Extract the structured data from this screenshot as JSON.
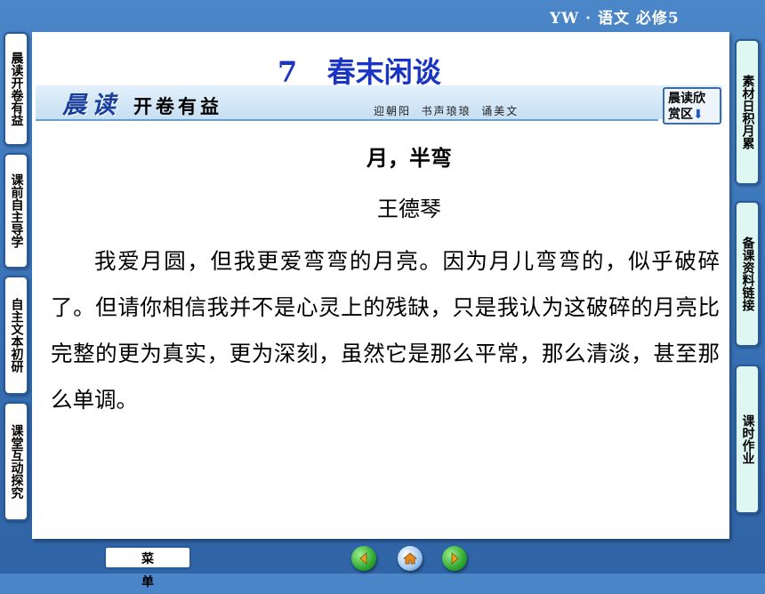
{
  "header": {
    "course": "YW · 语文   必修5"
  },
  "lesson": {
    "title": "7   春末闲谈"
  },
  "banner": {
    "brand": "晨读",
    "tagline": "开卷有益",
    "motto": "迎朝阳  书声琅琅  诵美文"
  },
  "appreciate_button": {
    "line1": "晨读欣",
    "line2": "赏区",
    "arrow": "⬇"
  },
  "poem": {
    "title": "月，半弯",
    "author": "王德琴",
    "body": "我爱月圆，但我更爱弯弯的月亮。因为月儿弯弯的，似乎破碎了。但请你相信我并不是心灵上的残缺，只是我认为这破碎的月亮比完整的更为真实，更为深刻，虽然它是那么平常，那么清淡，甚至那么单调。"
  },
  "left_tabs": [
    {
      "label": "晨读开卷有益"
    },
    {
      "label": "课前自主导学"
    },
    {
      "label": "自主文本初研"
    },
    {
      "label": "课堂互动探究"
    }
  ],
  "right_tabs": [
    {
      "label": "素材日积月累"
    },
    {
      "label": "备课资料链接"
    },
    {
      "label": "课时作业"
    }
  ],
  "bottom": {
    "menu_label": "菜单"
  },
  "icons": {
    "prev": "prev-arrow-icon",
    "home": "home-icon",
    "next": "next-arrow-icon"
  },
  "colors": {
    "background": "#3a73b8",
    "title_blue": "#1a35c4",
    "brand_blue": "#1a3f9c",
    "nav_green": "#2fa82f"
  }
}
